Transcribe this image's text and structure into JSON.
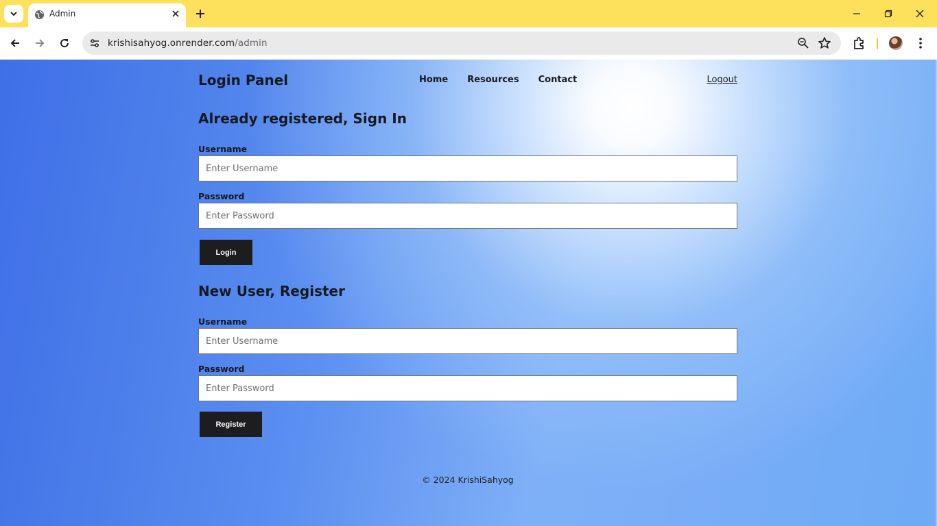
{
  "browser": {
    "tab_title": "Admin",
    "url_host": "krishisahyog.onrender.com",
    "url_path": "/admin"
  },
  "site": {
    "brand": "Login Panel",
    "nav": [
      "Home",
      "Resources",
      "Contact"
    ],
    "logout": "Logout"
  },
  "signin": {
    "title": "Already registered, Sign In",
    "username_label": "Username",
    "username_placeholder": "Enter Username",
    "password_label": "Password",
    "password_placeholder": "Enter Password",
    "button": "Login"
  },
  "register": {
    "title": "New User, Register",
    "username_label": "Username",
    "username_placeholder": "Enter Username",
    "password_label": "Password",
    "password_placeholder": "Enter Password",
    "button": "Register"
  },
  "footer": "© 2024 KrishiSahyog",
  "colors": {
    "tabbar": "#fde05c",
    "button": "#1d1d1f",
    "page_gradient_dark": "#3f6fe6",
    "page_gradient_light": "#7fb0f7"
  }
}
